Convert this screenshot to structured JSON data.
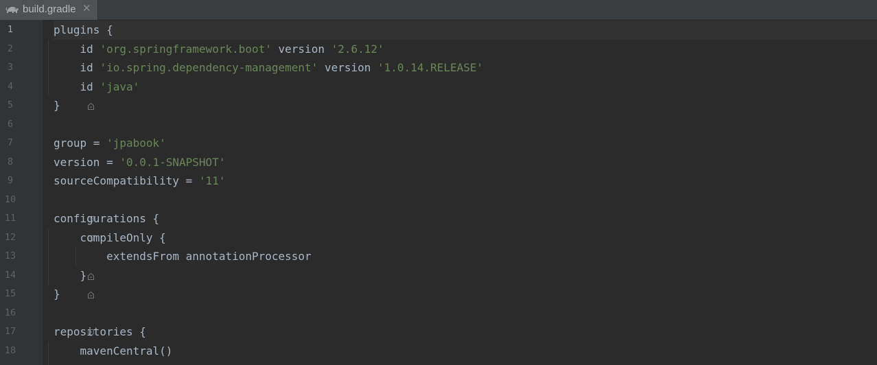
{
  "tab": {
    "filename": "build.gradle",
    "icon": "gradle-elephant-icon",
    "close_glyph": "✕"
  },
  "colors": {
    "editor_bg": "#2b2b2b",
    "gutter_bg": "#313335",
    "tab_bg": "#4e5254",
    "plain_text": "#a9b7c6",
    "string_text": "#6a8759",
    "line_number": "#606366"
  },
  "editor": {
    "current_line": 1,
    "lines": [
      {
        "number": "1",
        "tokens": [
          {
            "t": "plugins {",
            "k": "plain"
          }
        ],
        "fold": "open"
      },
      {
        "number": "2",
        "tokens": [
          {
            "t": "    id ",
            "k": "plain"
          },
          {
            "t": "'org.springframework.boot'",
            "k": "str"
          },
          {
            "t": " version ",
            "k": "plain"
          },
          {
            "t": "'2.6.12'",
            "k": "str"
          }
        ],
        "fold": ""
      },
      {
        "number": "3",
        "tokens": [
          {
            "t": "    id ",
            "k": "plain"
          },
          {
            "t": "'io.spring.dependency-management'",
            "k": "str"
          },
          {
            "t": " version ",
            "k": "plain"
          },
          {
            "t": "'1.0.14.RELEASE'",
            "k": "str"
          }
        ],
        "fold": ""
      },
      {
        "number": "4",
        "tokens": [
          {
            "t": "    id ",
            "k": "plain"
          },
          {
            "t": "'java'",
            "k": "str"
          }
        ],
        "fold": ""
      },
      {
        "number": "5",
        "tokens": [
          {
            "t": "}",
            "k": "plain"
          }
        ],
        "fold": "close"
      },
      {
        "number": "6",
        "tokens": [],
        "fold": ""
      },
      {
        "number": "7",
        "tokens": [
          {
            "t": "group = ",
            "k": "plain"
          },
          {
            "t": "'jpabook'",
            "k": "str"
          }
        ],
        "fold": ""
      },
      {
        "number": "8",
        "tokens": [
          {
            "t": "version = ",
            "k": "plain"
          },
          {
            "t": "'0.0.1-SNAPSHOT'",
            "k": "str"
          }
        ],
        "fold": ""
      },
      {
        "number": "9",
        "tokens": [
          {
            "t": "sourceCompatibility = ",
            "k": "plain"
          },
          {
            "t": "'11'",
            "k": "str"
          }
        ],
        "fold": ""
      },
      {
        "number": "10",
        "tokens": [],
        "fold": ""
      },
      {
        "number": "11",
        "tokens": [
          {
            "t": "configurations {",
            "k": "plain"
          }
        ],
        "fold": "open"
      },
      {
        "number": "12",
        "tokens": [
          {
            "t": "    compileOnly {",
            "k": "plain"
          }
        ],
        "fold": "open"
      },
      {
        "number": "13",
        "tokens": [
          {
            "t": "        extendsFrom annotationProcessor",
            "k": "plain"
          }
        ],
        "fold": ""
      },
      {
        "number": "14",
        "tokens": [
          {
            "t": "    }",
            "k": "plain"
          }
        ],
        "fold": "close"
      },
      {
        "number": "15",
        "tokens": [
          {
            "t": "}",
            "k": "plain"
          }
        ],
        "fold": "close"
      },
      {
        "number": "16",
        "tokens": [],
        "fold": ""
      },
      {
        "number": "17",
        "tokens": [
          {
            "t": "repositories {",
            "k": "plain"
          }
        ],
        "fold": "open"
      },
      {
        "number": "18",
        "tokens": [
          {
            "t": "    mavenCentral()",
            "k": "plain"
          }
        ],
        "fold": ""
      }
    ]
  }
}
